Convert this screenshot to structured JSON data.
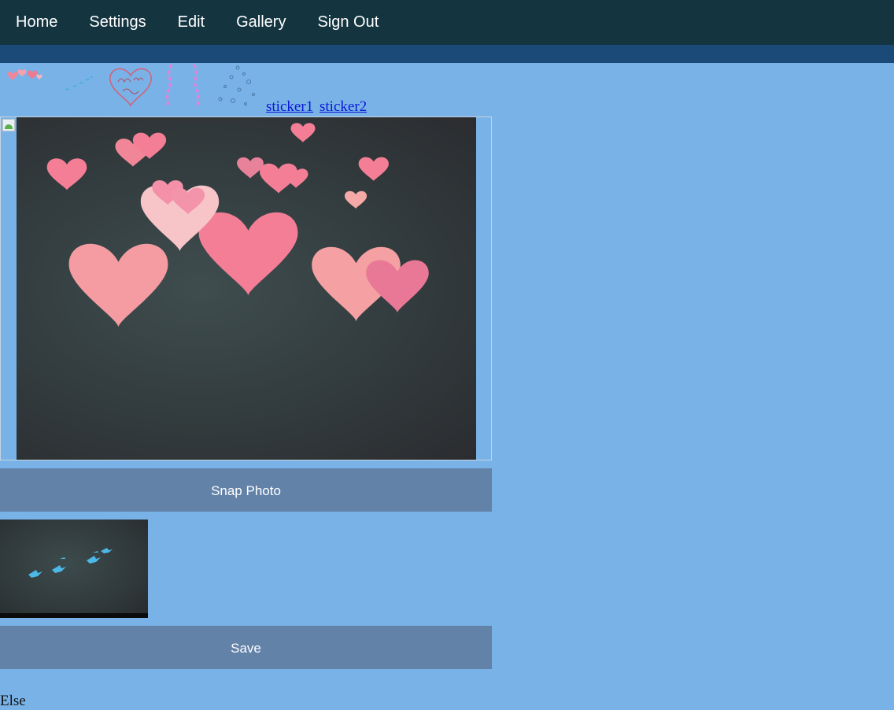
{
  "nav": {
    "items": [
      "Home",
      "Settings",
      "Edit",
      "Gallery",
      "Sign Out"
    ]
  },
  "stickers": {
    "icons": [
      "hearts-sticker-icon",
      "birds-sticker-icon",
      "miss-you-heart-sticker-icon",
      "pink-ribbons-sticker-icon",
      "bubbles-sticker-icon"
    ],
    "links": [
      "sticker1",
      "sticker2"
    ]
  },
  "camera": {
    "overlay_icon": "hearts-overlay-icon",
    "broken_image_icon": "broken-image-icon"
  },
  "buttons": {
    "snap": "Snap Photo",
    "save": "Save"
  },
  "snapshot": {
    "overlay_icon": "birds-overlay-icon"
  },
  "footer_text": "Else",
  "colors": {
    "page_background": "#78b2e6",
    "nav_background": "#143540",
    "subbar": "#1c4a78",
    "button": "#6282a8",
    "link": "#0a16d8"
  }
}
